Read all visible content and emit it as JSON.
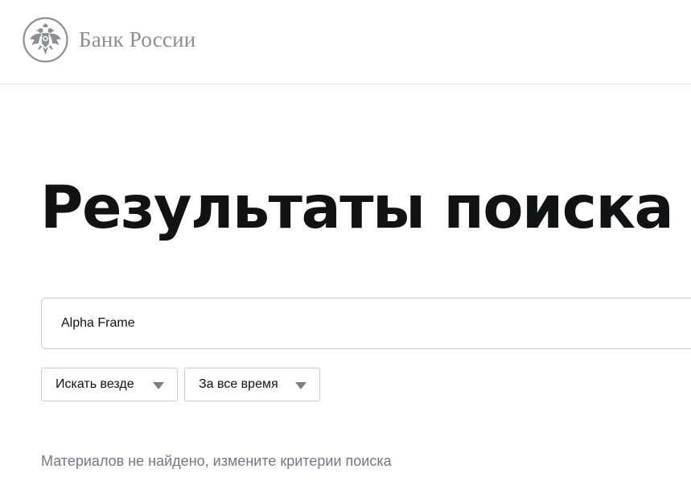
{
  "header": {
    "logo_text": "Банк России",
    "logo_icon": "double-headed-eagle-emblem"
  },
  "main": {
    "title": "Результаты поиска",
    "search": {
      "value": "Alpha Frame",
      "placeholder": ""
    },
    "filters": {
      "scope": {
        "selected": "Искать везде",
        "icon": "triangle-down-icon"
      },
      "period": {
        "selected": "За все время",
        "icon": "triangle-down-icon"
      }
    },
    "empty_message": "Материалов не найдено, измените критерии поиска"
  },
  "colors": {
    "logo": "#8a8e97",
    "title": "#111214",
    "border": "#c9ccd1",
    "muted_text": "#727884",
    "arrow": "#7a7f88"
  }
}
